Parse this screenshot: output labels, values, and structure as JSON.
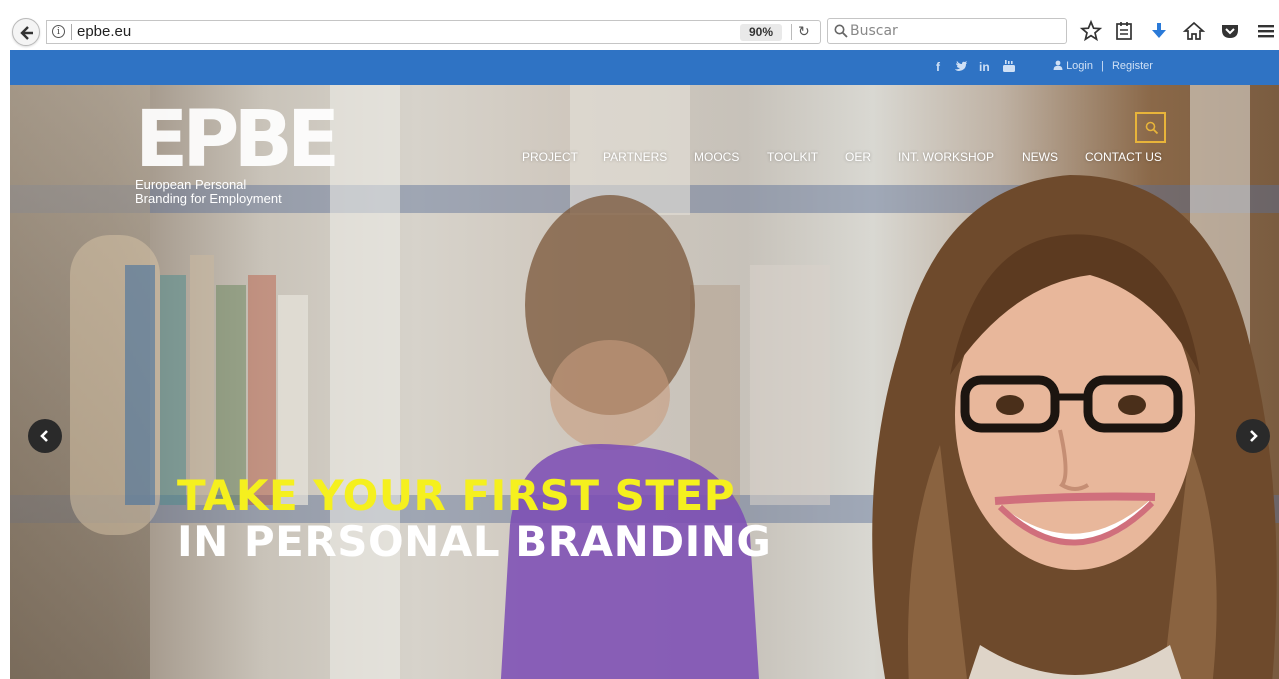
{
  "browser": {
    "url": "epbe.eu",
    "zoom": "90%",
    "search_placeholder": "Buscar",
    "icons": [
      "back-arrow-icon",
      "info-icon",
      "reload-icon",
      "search-icon",
      "bookmark-star-icon",
      "reading-list-icon",
      "download-icon",
      "home-icon",
      "pocket-icon",
      "hamburger-menu-icon"
    ]
  },
  "topbar": {
    "social": [
      "f",
      "𝐟",
      "in",
      "▣"
    ],
    "social_icons": [
      "facebook-icon",
      "twitter-icon",
      "linkedin-icon",
      "youtube-icon"
    ],
    "login": "Login",
    "separator": "|",
    "register": "Register",
    "color": "#2f73c4"
  },
  "site": {
    "logo_mark": "EPBE",
    "logo_line1": "European Personal",
    "logo_line2": "Branding for Employment",
    "nav": [
      "PROJECT",
      "PARTNERS",
      "MOOCS",
      "TOOLKIT",
      "OER",
      "INT. WORKSHOP",
      "NEWS",
      "CONTACT US"
    ],
    "search_button_color": "#e8b43a"
  },
  "hero": {
    "headline_line1": "TAKE YOUR FIRST STEP",
    "headline_line2": "IN PERSONAL BRANDING",
    "headline_color1": "#f5f01e",
    "headline_color2": "#ffffff"
  }
}
